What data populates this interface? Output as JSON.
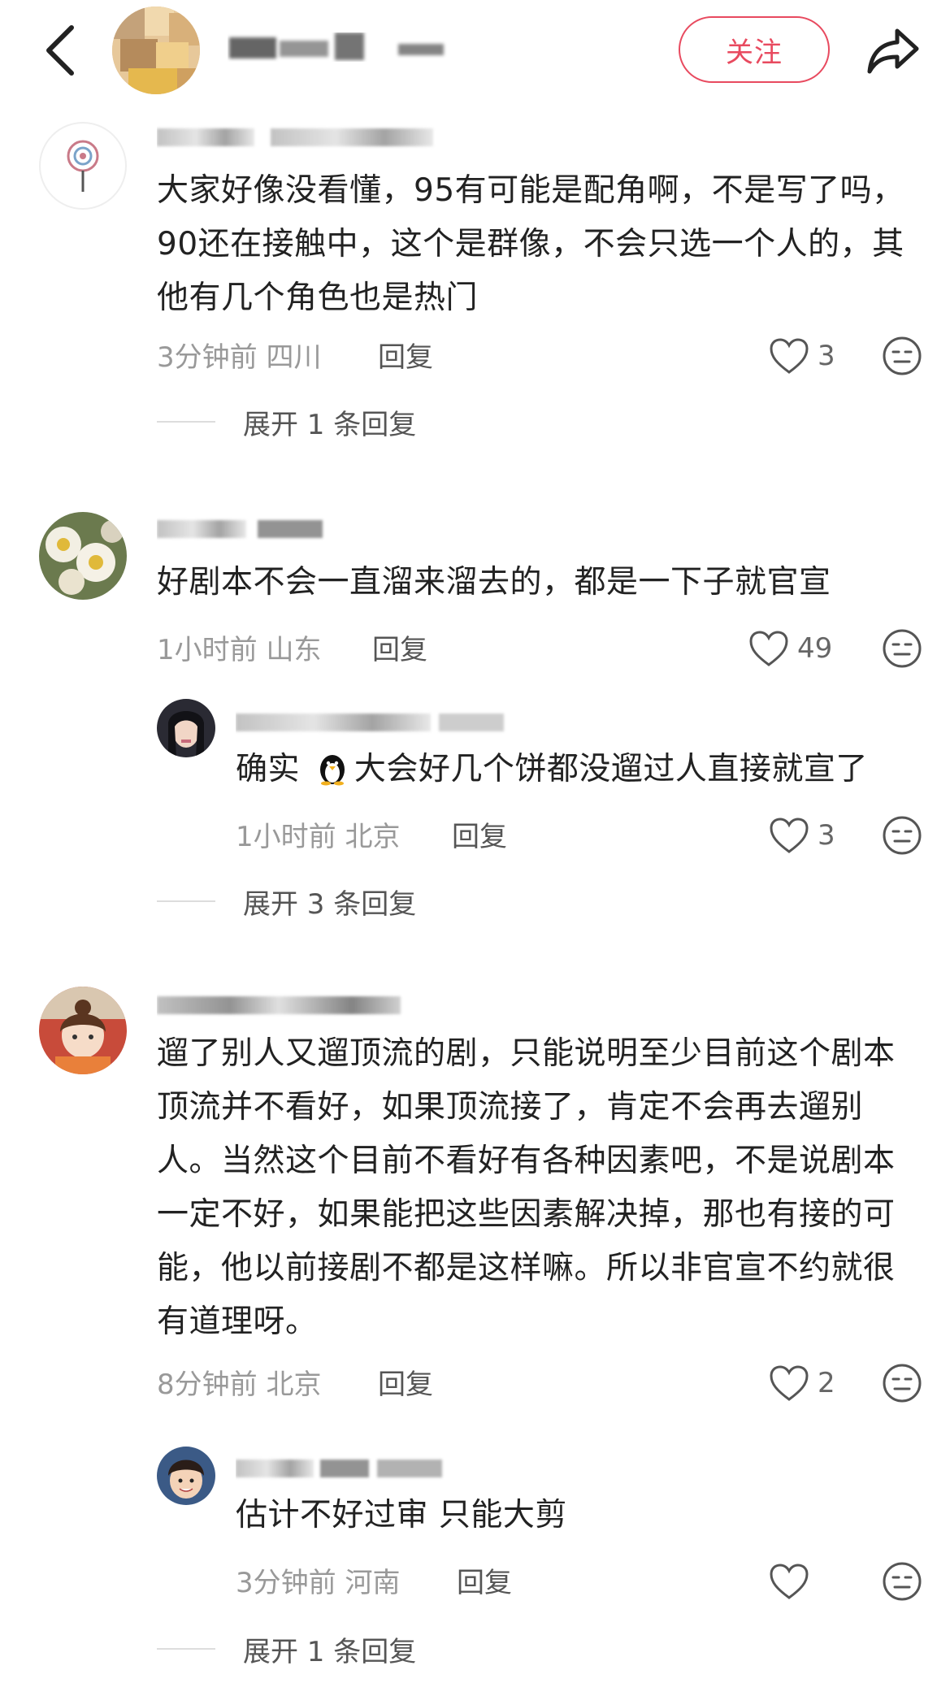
{
  "header": {
    "follow_label": "关注",
    "back_icon": "chevron-left-icon",
    "share_icon": "share-arrow-icon",
    "accent_color": "#e84a5f"
  },
  "comments": [
    {
      "text": "大家好像没看懂，95有可能是配角啊，不是写了吗，90还在接触中，这个是群像，不会只选一个人的，其他有几个角色也是热门",
      "time": "3分钟前",
      "location": "四川",
      "reply_label": "回复",
      "likes": "3",
      "expand_label": "展开 1 条回复"
    },
    {
      "text": "好剧本不会一直溜来溜去的，都是一下子就官宣",
      "time": "1小时前",
      "location": "山东",
      "reply_label": "回复",
      "likes": "49",
      "sub": {
        "text_before": "确实 ",
        "text_after": "大会好几个饼都没遛过人直接就宣了",
        "time": "1小时前",
        "location": "北京",
        "reply_label": "回复",
        "likes": "3"
      },
      "expand_label": "展开 3 条回复"
    },
    {
      "text": "遛了别人又遛顶流的剧，只能说明至少目前这个剧本顶流并不看好，如果顶流接了，肯定不会再去遛别人。当然这个目前不看好有各种因素吧，不是说剧本一定不好，如果能把这些因素解决掉，那也有接的可能，他以前接剧不都是这样嘛。所以非官宣不约就很有道理呀。",
      "time": "8分钟前",
      "location": "北京",
      "reply_label": "回复",
      "likes": "2",
      "sub": {
        "text": "估计不好过审 只能大剪",
        "time": "3分钟前",
        "location": "河南",
        "reply_label": "回复",
        "likes": ""
      },
      "expand_label": "展开 1 条回复"
    }
  ]
}
